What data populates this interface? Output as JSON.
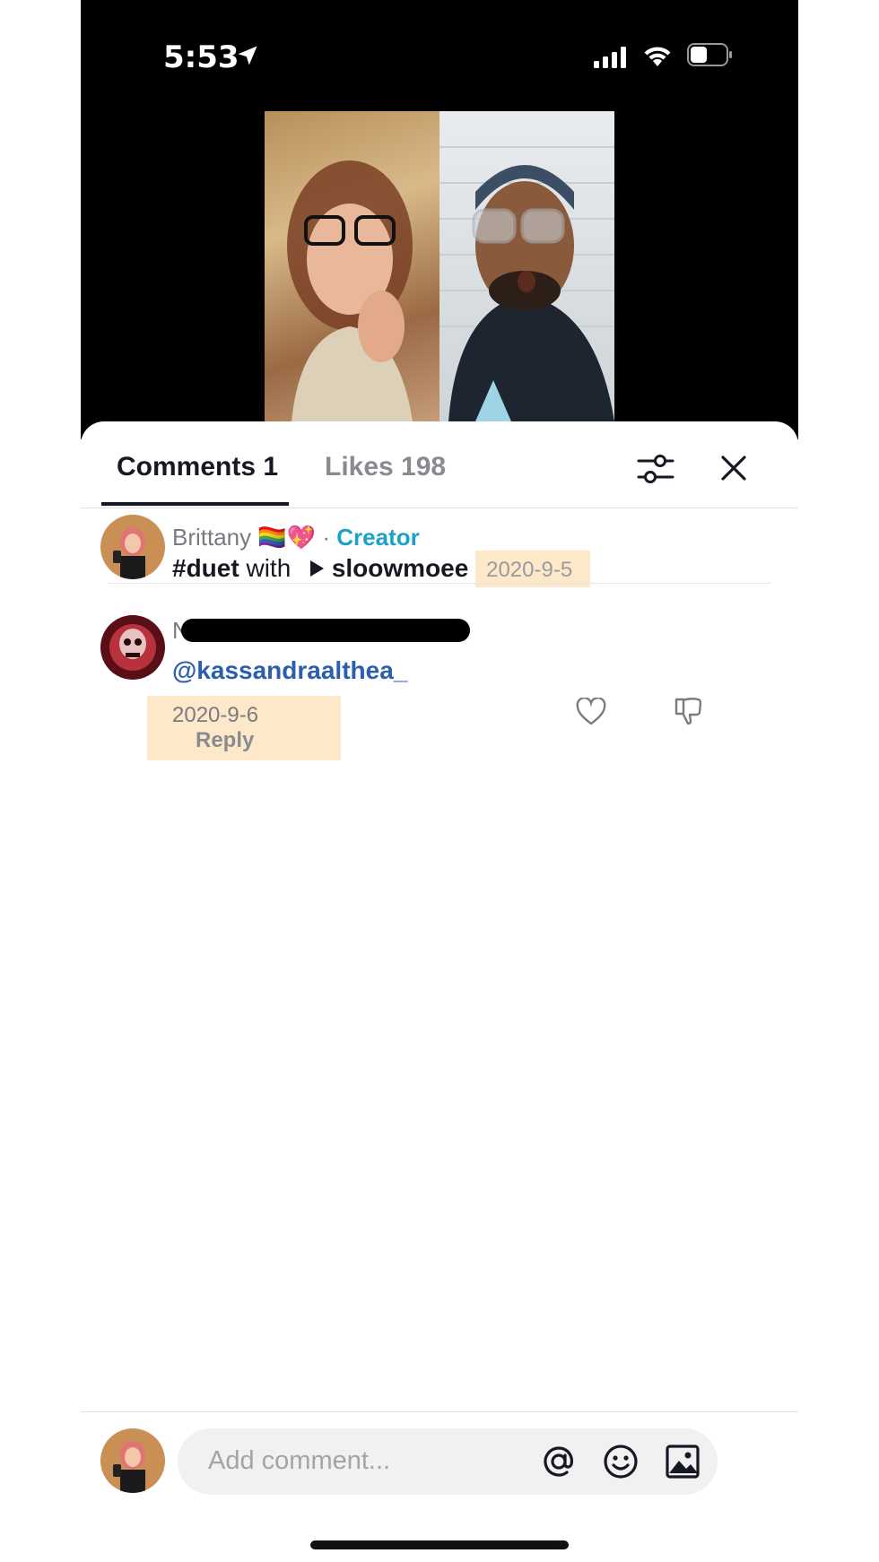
{
  "status_bar": {
    "time": "5:53"
  },
  "tabs": {
    "comments_label": "Comments 1",
    "likes_label": "Likes 198"
  },
  "comments": [
    {
      "author": "Brittany 🏳️‍🌈💖",
      "separator": "·",
      "badge": "Creator",
      "hashtag": "#duet",
      "text_with": "with",
      "mention_user": "sloowmoee",
      "date": "2020-9-5"
    },
    {
      "author_initial": "N",
      "mention": "@kassandraalthea_",
      "date": "2020-9-6",
      "reply_label": "Reply"
    }
  ],
  "composer": {
    "placeholder": "Add comment..."
  },
  "colors": {
    "creator_badge": "#1ca2c7",
    "mention": "#2b5fad",
    "highlight": "#fde9c9"
  },
  "icons": [
    "location-arrow-icon",
    "signal-icon",
    "wifi-icon",
    "battery-icon",
    "filter-icon",
    "close-icon",
    "play-icon",
    "heart-icon",
    "dislike-icon",
    "at-icon",
    "emoji-icon",
    "image-icon"
  ]
}
